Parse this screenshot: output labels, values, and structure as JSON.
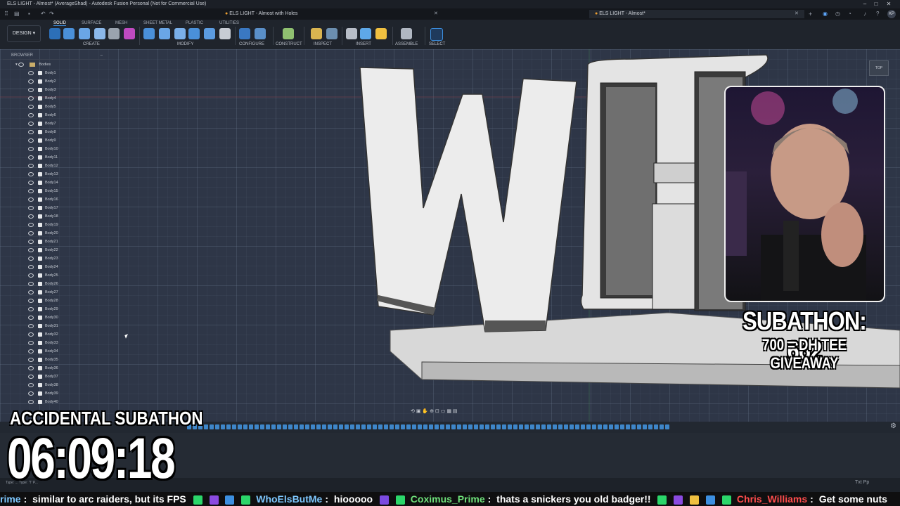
{
  "window": {
    "title": "ELS LIGHT - Almost* (AverageShad) - Autodesk Fusion Personal (Not for Commercial Use)",
    "controls": [
      "–",
      "□",
      "✕"
    ]
  },
  "tabs": [
    {
      "label": "ELS LIGHT - Almost with Holes",
      "active": false
    },
    {
      "label": "ELS LIGHT - Almost*",
      "active": true
    }
  ],
  "account_initials": "KP",
  "toolbar": {
    "design_label": "DESIGN",
    "ribbon_tabs": [
      "SOLID",
      "SURFACE",
      "MESH",
      "SHEET METAL",
      "PLASTIC",
      "UTILITIES"
    ],
    "groups": [
      "CREATE",
      "MODIFY",
      "CONFIGURE",
      "CONSTRUCT",
      "INSPECT",
      "INSERT",
      "ASSEMBLE",
      "SELECT"
    ]
  },
  "browser": {
    "title": "BROWSER",
    "folder": "Bodies",
    "bodies": [
      "Body1",
      "Body2",
      "Body3",
      "Body4",
      "Body5",
      "Body6",
      "Body7",
      "Body8",
      "Body9",
      "Body10",
      "Body11",
      "Body12",
      "Body13",
      "Body14",
      "Body15",
      "Body16",
      "Body17",
      "Body18",
      "Body19",
      "Body20",
      "Body21",
      "Body22",
      "Body23",
      "Body24",
      "Body25",
      "Body26",
      "Body27",
      "Body28",
      "Body29",
      "Body30",
      "Body31",
      "Body32",
      "Body33",
      "Body34",
      "Body35",
      "Body36",
      "Body37",
      "Body38",
      "Body39",
      "Body40"
    ]
  },
  "viewcube": {
    "label": "TOP"
  },
  "overlay": {
    "subathon_count": "SUBATHON: 662",
    "goal": "700 = DH TEE GIVEAWAY",
    "label": "ACCIDENTAL SUBATHON",
    "timer": "06:09:18"
  },
  "status_bar": {
    "left": "Type: ... Type: 'T' P...",
    "right": "Txt  Pp"
  },
  "chat": [
    {
      "user": "rime",
      "color": "#7ec8ff",
      "text": "similar to arc raiders, but its FPS"
    },
    {
      "user": "WhoElsButMe",
      "color": "#7ec8ff",
      "text": "hiooooo"
    },
    {
      "user": "Coximus_Prime",
      "color": "#6ee07a",
      "text": "thats a snickers you old badger!!"
    },
    {
      "user": "Chris_Williams",
      "color": "#ff4d4d",
      "text": "Get some nuts"
    }
  ],
  "colors": {
    "accent": "#3c8fe0",
    "viewport": "#2e3647",
    "model": "#e6e6e6"
  }
}
